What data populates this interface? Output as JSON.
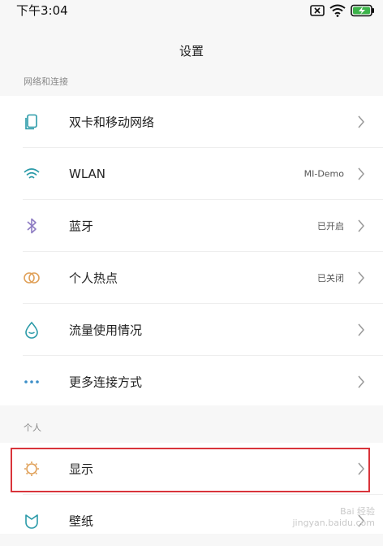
{
  "status_bar": {
    "time": "下午3:04"
  },
  "header": {
    "title": "设置"
  },
  "sections": {
    "network": {
      "label": "网络和连接",
      "items": [
        {
          "label": "双卡和移动网络",
          "value": "",
          "icon": "sim-card-icon"
        },
        {
          "label": "WLAN",
          "value": "MI-Demo",
          "icon": "wifi-icon"
        },
        {
          "label": "蓝牙",
          "value": "已开启",
          "icon": "bluetooth-icon"
        },
        {
          "label": "个人热点",
          "value": "已关闭",
          "icon": "hotspot-icon"
        },
        {
          "label": "流量使用情况",
          "value": "",
          "icon": "data-usage-icon"
        },
        {
          "label": "更多连接方式",
          "value": "",
          "icon": "more-connections-icon"
        }
      ]
    },
    "personal": {
      "label": "个人",
      "items": [
        {
          "label": "显示",
          "value": "",
          "icon": "display-icon"
        },
        {
          "label": "壁纸",
          "value": "",
          "icon": "wallpaper-icon"
        }
      ]
    }
  },
  "watermark": {
    "line1": "Bai 经验",
    "line2": "jingyan.baidu.com"
  },
  "colors": {
    "background": "#f7f7f7",
    "card": "#ffffff",
    "highlight": "#d9343b",
    "icon_teal": "#2a9aa8",
    "icon_purple": "#8e7cc3",
    "icon_orange": "#e0a15a",
    "icon_blue": "#3b8ec7"
  }
}
